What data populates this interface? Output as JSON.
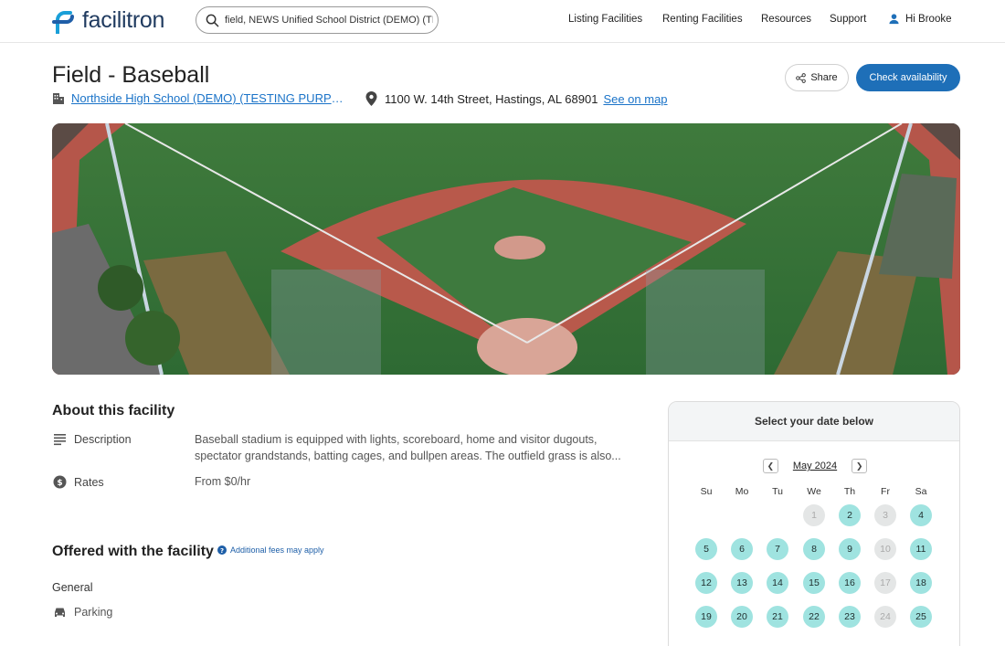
{
  "header": {
    "logo_text": "facilitron",
    "search_value": "field, NEWS Unified School District (DEMO) (TI",
    "nav": [
      "Listing Facilities",
      "Renting Facilities",
      "Resources",
      "Support"
    ],
    "user_greeting": "Hi Brooke"
  },
  "facility": {
    "title": "Field - Baseball",
    "school": "Northside High School (DEMO) (TESTING PURPOS...",
    "address": "1100 W. 14th Street, Hastings, AL 68901",
    "map_link": "See on map",
    "share_label": "Share",
    "check_label": "Check availability"
  },
  "about": {
    "title": "About this facility",
    "description_label": "Description",
    "description_text": "Baseball stadium is equipped with lights, scoreboard, home and visitor dugouts, spectator grandstands, batting cages, and bullpen areas. The outfield grass is also...",
    "rates_label": "Rates",
    "rates_text": "From $0/hr"
  },
  "offered": {
    "title": "Offered with the facility",
    "fees_note": "Additional fees may apply",
    "general": "General",
    "parking": "Parking"
  },
  "calendar": {
    "header": "Select your date below",
    "month": "May 2024",
    "weekdays": [
      "Su",
      "Mo",
      "Tu",
      "We",
      "Th",
      "Fr",
      "Sa"
    ],
    "weeks": [
      [
        null,
        null,
        null,
        {
          "d": "1",
          "a": false
        },
        {
          "d": "2",
          "a": true
        },
        {
          "d": "3",
          "a": false
        },
        {
          "d": "4",
          "a": true
        }
      ],
      [
        {
          "d": "5",
          "a": true
        },
        {
          "d": "6",
          "a": true
        },
        {
          "d": "7",
          "a": true
        },
        {
          "d": "8",
          "a": true
        },
        {
          "d": "9",
          "a": true
        },
        {
          "d": "10",
          "a": false
        },
        {
          "d": "11",
          "a": true
        }
      ],
      [
        {
          "d": "12",
          "a": true
        },
        {
          "d": "13",
          "a": true
        },
        {
          "d": "14",
          "a": true
        },
        {
          "d": "15",
          "a": true
        },
        {
          "d": "16",
          "a": true
        },
        {
          "d": "17",
          "a": false
        },
        {
          "d": "18",
          "a": true
        }
      ],
      [
        {
          "d": "19",
          "a": true
        },
        {
          "d": "20",
          "a": true
        },
        {
          "d": "21",
          "a": true
        },
        {
          "d": "22",
          "a": true
        },
        {
          "d": "23",
          "a": true
        },
        {
          "d": "24",
          "a": false
        },
        {
          "d": "25",
          "a": true
        }
      ]
    ]
  },
  "colors": {
    "brand": "#1e6fb8",
    "available_day": "#9fe3e0",
    "unavailable_day": "#e4e6e6"
  }
}
